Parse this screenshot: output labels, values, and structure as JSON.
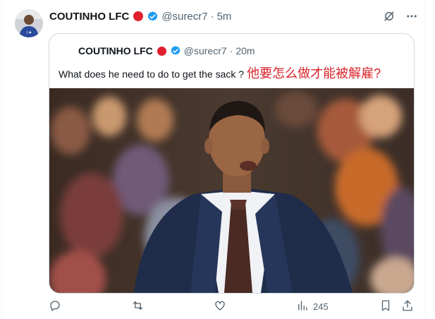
{
  "tweet": {
    "display_name": "COUTINHO LFC",
    "handle": "@surecr7",
    "separator": "·",
    "time": "5m"
  },
  "quoted": {
    "display_name": "COUTINHO LFC",
    "handle": "@surecr7",
    "separator": "·",
    "time": "20m",
    "text": "What does he need to do to get the sack ?",
    "text_zh": "他要怎么做才能被解雇?",
    "image": "photo-coach-in-suit"
  },
  "actions": {
    "reply_icon": "reply-icon",
    "retweet_icon": "retweet-icon",
    "like_icon": "like-icon",
    "views_icon": "views-icon",
    "views_count": "245",
    "bookmark_icon": "bookmark-icon",
    "share_icon": "share-icon"
  },
  "top_icons": [
    "grok-icon",
    "more-icon"
  ],
  "colors": {
    "accent_red": "#e0202e",
    "verified_blue": "#1d9bf0",
    "muted": "#536471",
    "zh_text": "#d9232a"
  }
}
